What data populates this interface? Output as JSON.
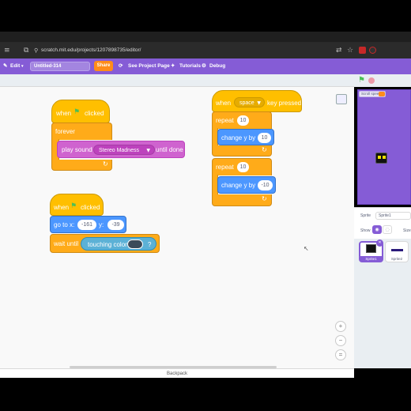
{
  "browser": {
    "url": "scratch.mit.edu/projects/1207898735/editor/",
    "nav_icons": [
      "back-arrow",
      "forward-arrow",
      "reload",
      "home"
    ],
    "ext_icons": [
      "translate",
      "bookmark-star",
      "extensions",
      "profile"
    ]
  },
  "menubar": {
    "edit": "Edit",
    "project_title": "Untitled-314",
    "share": "Share",
    "see_project_page": "See Project Page",
    "tutorials": "Tutorials",
    "debug": "Debug"
  },
  "script1": {
    "hat_when": "when",
    "hat_clicked": "clicked",
    "forever": "forever",
    "play_sound": "play sound",
    "sound_name": "Stereo Madness",
    "until_done": "until done"
  },
  "script2": {
    "hat_when": "when",
    "hat_clicked": "clicked",
    "goto": "go to x:",
    "x": "-161",
    "y_label": "y:",
    "y": "-39",
    "wait_until": "wait until",
    "touching_color": "touching color",
    "question": "?"
  },
  "script3": {
    "hat_when": "when",
    "key": "space",
    "key_pressed": "key pressed",
    "repeat1_label": "repeat",
    "repeat1_count": "10",
    "change1_label": "change y by",
    "change1_value": "10",
    "repeat2_label": "repeat",
    "repeat2_count": "10",
    "change2_label": "change y by",
    "change2_value": "-10"
  },
  "stage": {
    "monitor_label": "Scroll speed"
  },
  "sprite_info": {
    "sprite_label": "Sprite",
    "sprite_name": "Sprite1",
    "show_label": "Show",
    "size_label": "Size"
  },
  "sprites": [
    {
      "name": "Sprite1",
      "selected": true
    },
    {
      "name": "Sprite2",
      "selected": false
    }
  ],
  "backpack": "Backpack",
  "colors": {
    "scratch_purple": "#855cd6",
    "events": "#ffbf00",
    "control": "#ffab19",
    "sound": "#cf63cf",
    "motion": "#4c97ff",
    "sensing": "#5cb1d6",
    "touching_color_swatch": "#3a4a5a"
  }
}
